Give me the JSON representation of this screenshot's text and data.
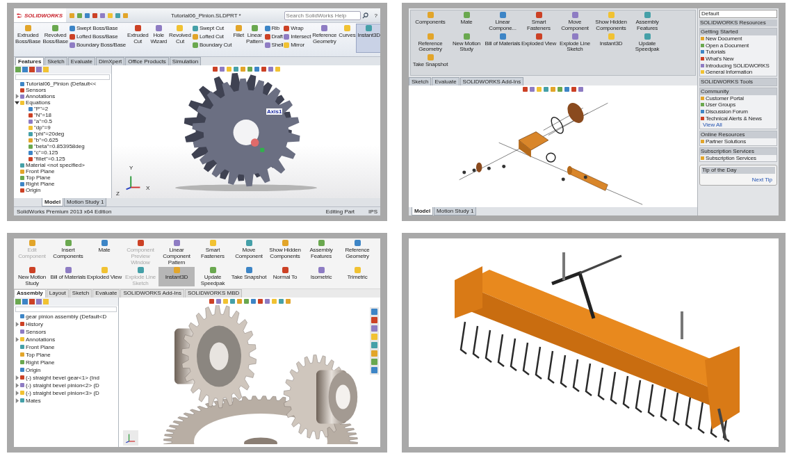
{
  "part_window": {
    "logo": "SOLIDWORKS",
    "title": "Tutorial06_Pinion.SLDPRT *",
    "search": {
      "placeholder": "Search SolidWorks Help"
    },
    "help": "?",
    "ribbon": [
      {
        "kind": "large",
        "label": "Extruded Boss/Base",
        "selected": false
      },
      {
        "kind": "large",
        "label": "Revolved Boss/Base",
        "selected": false
      },
      {
        "kind": "stack",
        "items": [
          "Swept Boss/Base",
          "Lofted Boss/Base",
          "Boundary Boss/Base"
        ]
      },
      {
        "kind": "large",
        "label": "Extruded Cut",
        "selected": false
      },
      {
        "kind": "large",
        "label": "Hole Wizard",
        "selected": false
      },
      {
        "kind": "large",
        "label": "Revolved Cut",
        "selected": false
      },
      {
        "kind": "stack",
        "items": [
          "Swept Cut",
          "Lofted Cut",
          "Boundary Cut"
        ]
      },
      {
        "kind": "large",
        "label": "Fillet",
        "selected": false
      },
      {
        "kind": "large",
        "label": "Linear Pattern",
        "selected": false
      },
      {
        "kind": "stack",
        "items": [
          "Rib",
          "Draft",
          "Shell"
        ]
      },
      {
        "kind": "stack",
        "items": [
          "Wrap",
          "Intersect",
          "Mirror"
        ]
      },
      {
        "kind": "large",
        "label": "Reference Geometry",
        "selected": false
      },
      {
        "kind": "large",
        "label": "Curves",
        "selected": false
      },
      {
        "kind": "large",
        "label": "Instant3D",
        "selected": true
      }
    ],
    "tabs": [
      {
        "label": "Features",
        "selected": true
      },
      {
        "label": "Sketch",
        "selected": false
      },
      {
        "label": "Evaluate",
        "selected": false
      },
      {
        "label": "DimXpert",
        "selected": false
      },
      {
        "label": "Office Products",
        "selected": false
      },
      {
        "label": "Simulation",
        "selected": false
      }
    ],
    "tree": [
      {
        "label": "Tutorial06_Pinion  (Default<<"
      },
      {
        "label": "Sensors"
      },
      {
        "label": "Annotations",
        "expanded": false
      },
      {
        "label": "Equations",
        "expanded": true,
        "children": [
          {
            "label": "\"P\"=2"
          },
          {
            "label": "\"N\"=18"
          },
          {
            "label": "\"a\"=0.5"
          },
          {
            "label": "\"dp\"=9"
          },
          {
            "label": "\"phi\"=20deg"
          },
          {
            "label": "\"b\"=0.625"
          },
          {
            "label": "\"beta\"=0.853958deg"
          },
          {
            "label": "\"c\"=0.125"
          },
          {
            "label": "\"fillet\"=0.125"
          }
        ]
      },
      {
        "label": "Material <not specified>"
      },
      {
        "label": "Front Plane"
      },
      {
        "label": "Top Plane"
      },
      {
        "label": "Right Plane"
      },
      {
        "label": "Origin"
      }
    ],
    "axis_label": "Axis1",
    "triad": [
      "X",
      "Y",
      "Z"
    ],
    "bottom_tabs": [
      {
        "label": "Model",
        "selected": true
      },
      {
        "label": "Motion Study 1",
        "selected": false
      }
    ],
    "status": {
      "edition": "SolidWorks Premium 2013 x64 Edition",
      "mode": "Editing Part",
      "units": "IPS"
    }
  },
  "exploded_window": {
    "ribbon": [
      {
        "kind": "large",
        "label": "Components",
        "selected": false
      },
      {
        "kind": "large",
        "label": "Mate",
        "selected": false
      },
      {
        "kind": "large",
        "label": "Linear Compone...",
        "selected": false
      },
      {
        "kind": "large",
        "label": "Smart Fasteners",
        "selected": false
      },
      {
        "kind": "large",
        "label": "Move Component",
        "selected": false
      },
      {
        "kind": "large",
        "label": "Show Hidden Components",
        "selected": false
      },
      {
        "kind": "large",
        "label": "Assembly Features",
        "selected": false
      },
      {
        "kind": "large",
        "label": "Reference Geometry",
        "selected": false
      },
      {
        "kind": "large",
        "label": "New Motion Study",
        "selected": false
      },
      {
        "kind": "large",
        "label": "Bill of Materials",
        "selected": false
      },
      {
        "kind": "large",
        "label": "Exploded View",
        "selected": false
      },
      {
        "kind": "large",
        "label": "Explode Line Sketch",
        "selected": false
      },
      {
        "kind": "large",
        "label": "Instant3D",
        "selected": false
      },
      {
        "kind": "large",
        "label": "Update Speedpak",
        "selected": false
      },
      {
        "kind": "large",
        "label": "Take Snapshot",
        "selected": false
      }
    ],
    "configuration": "Default",
    "tabs": [
      {
        "label": "Sketch",
        "selected": false
      },
      {
        "label": "Evaluate",
        "selected": false
      },
      {
        "label": "SOLIDWORKS Add-Ins",
        "selected": false
      }
    ],
    "task_pane": {
      "title": "SOLIDWORKS Resources",
      "sections": [
        {
          "title": "Getting Started",
          "items": [
            "New Document",
            "Open a Document",
            "Tutorials",
            "What's New",
            "Introducing SOLIDWORKS",
            "General Information"
          ]
        },
        {
          "title": "SOLIDWORKS Tools"
        },
        {
          "title": "Community",
          "items": [
            "Customer Portal",
            "User Groups",
            "Discussion Forum",
            "Technical Alerts & News"
          ],
          "link": "View All"
        },
        {
          "title": "Online Resources",
          "items": [
            "Partner Solutions"
          ]
        },
        {
          "title": "Subscription Services",
          "items": [
            "Subscription Services"
          ]
        }
      ],
      "tip": {
        "title": "Tip of the Day",
        "link": "Next Tip"
      }
    },
    "bottom_tabs": [
      {
        "label": "Model",
        "selected": true
      },
      {
        "label": "Motion Study 1",
        "selected": false
      }
    ]
  },
  "assembly_window": {
    "ribbon": [
      {
        "kind": "large",
        "label": "Edit Component",
        "selected": false,
        "disabled": true
      },
      {
        "kind": "large",
        "label": "Insert Components",
        "selected": false,
        "disabled": false
      },
      {
        "kind": "large",
        "label": "Mate",
        "selected": false,
        "disabled": false
      },
      {
        "kind": "large",
        "label": "Component Preview Window",
        "selected": false,
        "disabled": true
      },
      {
        "kind": "large",
        "label": "Linear Component Pattern",
        "selected": false,
        "disabled": false
      },
      {
        "kind": "large",
        "label": "Smart Fasteners",
        "selected": false,
        "disabled": false
      },
      {
        "kind": "large",
        "label": "Move Component",
        "selected": false,
        "disabled": false
      },
      {
        "kind": "large",
        "label": "Show Hidden Components",
        "selected": false,
        "disabled": false
      },
      {
        "kind": "large",
        "label": "Assembly Features",
        "selected": false,
        "disabled": false
      },
      {
        "kind": "large",
        "label": "Reference Geometry",
        "selected": false,
        "disabled": false
      },
      {
        "kind": "large",
        "label": "New Motion Study",
        "selected": false,
        "disabled": false
      },
      {
        "kind": "large",
        "label": "Bill of Materials",
        "selected": false,
        "disabled": false
      },
      {
        "kind": "large",
        "label": "Exploded View",
        "selected": false,
        "disabled": false
      },
      {
        "kind": "large",
        "label": "Explode Line Sketch",
        "selected": false,
        "disabled": true
      },
      {
        "kind": "large",
        "label": "Instant3D",
        "selected": true,
        "disabled": false
      },
      {
        "kind": "large",
        "label": "Update Speedpak",
        "selected": false,
        "disabled": false
      },
      {
        "kind": "large",
        "label": "Take Snapshot",
        "selected": false,
        "disabled": false
      },
      {
        "kind": "large",
        "label": "Normal To",
        "selected": false,
        "disabled": false
      },
      {
        "kind": "large",
        "label": "Isometric",
        "selected": false,
        "disabled": false
      },
      {
        "kind": "large",
        "label": "Trimetric",
        "selected": false,
        "disabled": false
      }
    ],
    "tabs": [
      {
        "label": "Assembly",
        "selected": true
      },
      {
        "label": "Layout",
        "selected": false
      },
      {
        "label": "Sketch",
        "selected": false
      },
      {
        "label": "Evaluate",
        "selected": false
      },
      {
        "label": "SOLIDWORKS Add-Ins",
        "selected": false
      },
      {
        "label": "SOLIDWORKS MBD",
        "selected": false
      }
    ],
    "tree": [
      {
        "label": "gear pinion assembly  (Default<D"
      },
      {
        "label": "History",
        "expanded": false
      },
      {
        "label": "Sensors"
      },
      {
        "label": "Annotations",
        "expanded": false
      },
      {
        "label": "Front Plane"
      },
      {
        "label": "Top Plane"
      },
      {
        "label": "Right Plane"
      },
      {
        "label": "Origin"
      },
      {
        "label": "(-) straight bevel gear<1> (Ind",
        "expanded": false
      },
      {
        "label": "(-) straight bevel pinion<2> (D",
        "expanded": false
      },
      {
        "label": "(-) straight bevel pinion<3> (D",
        "expanded": false
      },
      {
        "label": "Mates",
        "expanded": false
      }
    ]
  }
}
